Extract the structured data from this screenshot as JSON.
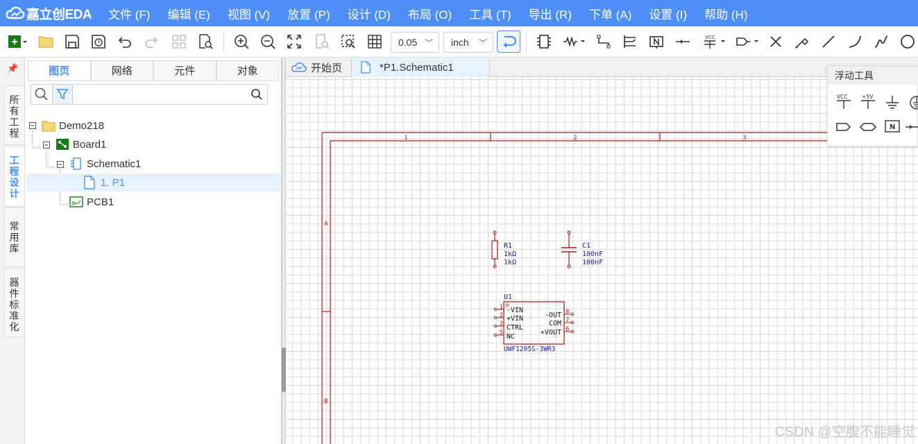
{
  "app": {
    "logo_text": "嘉立创EDA",
    "brand_color": "#4d8ff7"
  },
  "menu": [
    "文件 (F)",
    "编辑 (E)",
    "视图 (V)",
    "放置 (P)",
    "设计 (D)",
    "布局 (O)",
    "工具 (T)",
    "导出 (R)",
    "下单 (A)",
    "设置 (I)",
    "帮助 (H)"
  ],
  "toolbar": {
    "grid_value": "0.05",
    "unit": "inch"
  },
  "left_tabs": [
    "所有工程",
    "工程设计",
    "常用库",
    "器件标准化"
  ],
  "panel_tabs": [
    "图页",
    "网络",
    "元件",
    "对象"
  ],
  "tree": [
    {
      "label": "Demo218",
      "icon": "folder-icon"
    },
    {
      "label": "Board1",
      "icon": "board-icon"
    },
    {
      "label": "Schematic1",
      "icon": "schematic-icon"
    },
    {
      "label": "1. P1",
      "icon": "page-icon"
    },
    {
      "label": "PCB1",
      "icon": "pcb-icon"
    }
  ],
  "doc_tabs": [
    "开始页",
    "*P1.Schematic1"
  ],
  "float_tools": {
    "title": "浮动工具",
    "vcc": "VCC",
    "plus5v": "+5V",
    "netlabel": "N"
  },
  "schematic": {
    "frame_cols": [
      "1",
      "2",
      "3"
    ],
    "frame_rows": [
      "A",
      "B"
    ],
    "r1": {
      "ref": "R1",
      "val1": "1kΩ",
      "val2": "1kΩ"
    },
    "c1": {
      "ref": "C1",
      "val1": "100nF",
      "val2": "100nF"
    },
    "u1": {
      "ref": "U1",
      "part": "UWF1205S-3WR3",
      "left_pins": [
        {
          "num": "1",
          "name": "-VIN"
        },
        {
          "num": "2",
          "name": "+VIN"
        },
        {
          "num": "3",
          "name": "CTRL"
        },
        {
          "num": "5",
          "name": "NC"
        }
      ],
      "right_pins": [
        {
          "num": "8",
          "name": "-OUT"
        },
        {
          "num": "7",
          "name": "COM"
        },
        {
          "num": "6",
          "name": "+VOUT"
        }
      ]
    }
  },
  "watermark": "CSDN @空腹不能睡觉"
}
